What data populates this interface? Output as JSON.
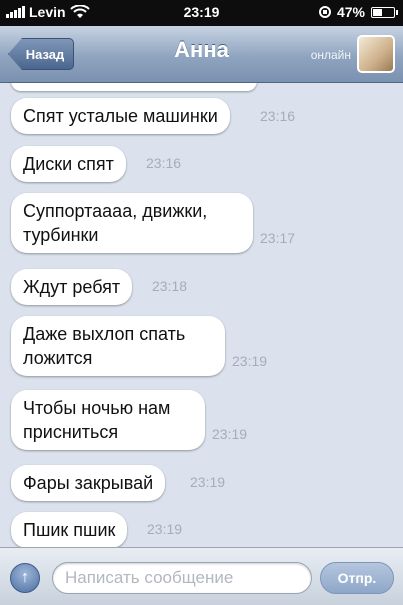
{
  "status_bar": {
    "carrier": "Levin",
    "time": "23:19",
    "battery": "47%",
    "battery_level": 0.47,
    "signal_icon": "signal-bars-icon",
    "wifi_icon": "wifi-icon",
    "lock_icon": "rotation-lock-icon"
  },
  "nav": {
    "back_label": "Назад",
    "title": "Анна",
    "status": "онлайн"
  },
  "messages": [
    {
      "text": "Спят усталые машинки",
      "time": "23:16"
    },
    {
      "text": "Диски спят",
      "time": "23:16"
    },
    {
      "text": "Суппортаааа, движки, турбинки",
      "time": "23:17"
    },
    {
      "text": "Ждут ребят",
      "time": "23:18"
    },
    {
      "text": "Даже выхлоп спать ложится",
      "time": "23:19"
    },
    {
      "text": "Чтобы ночью нам присниться",
      "time": "23:19"
    },
    {
      "text": "Фары закрывай",
      "time": "23:19"
    },
    {
      "text": "Пшик пшик",
      "time": "23:19"
    }
  ],
  "composer": {
    "placeholder": "Написать сообщение",
    "send_label": "Отпр.",
    "attach_icon": "arrow-up-icon"
  },
  "colors": {
    "chat_background": "#dbe2ed",
    "navbar": "#8fa4bf",
    "bubble": "#ffffff"
  }
}
